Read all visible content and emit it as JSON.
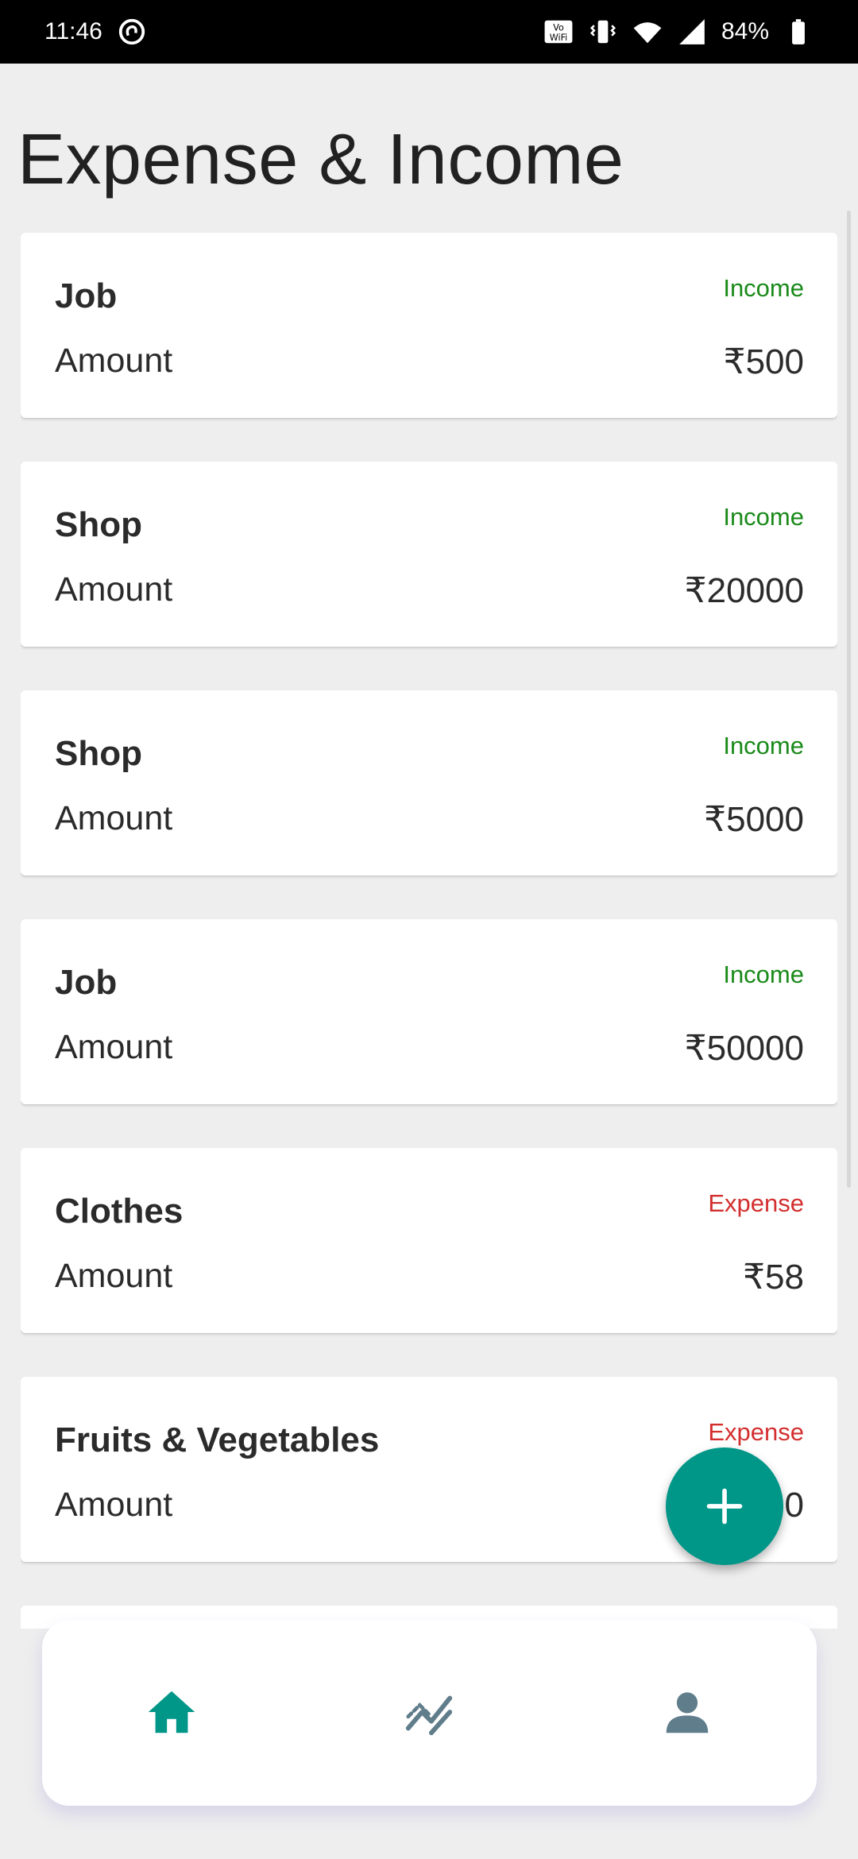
{
  "status_bar": {
    "time": "11:46",
    "battery": "84%",
    "icons": [
      "sync-icon",
      "vowifi-icon",
      "vibrate-icon",
      "wifi-icon",
      "signal-icon",
      "battery-icon"
    ]
  },
  "page": {
    "title": "Expense & Income"
  },
  "colors": {
    "accent": "#009688",
    "income": "#1a8a1a",
    "expense": "#d32f2f",
    "nav_inactive": "#607d8b"
  },
  "transactions": [
    {
      "category": "Job",
      "type": "Income",
      "amount_label": "Amount",
      "amount": "₹500"
    },
    {
      "category": "Shop",
      "type": "Income",
      "amount_label": "Amount",
      "amount": "₹20000"
    },
    {
      "category": "Shop",
      "type": "Income",
      "amount_label": "Amount",
      "amount": "₹5000"
    },
    {
      "category": "Job",
      "type": "Income",
      "amount_label": "Amount",
      "amount": "₹50000"
    },
    {
      "category": "Clothes",
      "type": "Expense",
      "amount_label": "Amount",
      "amount": "₹58"
    },
    {
      "category": "Fruits & Vegetables",
      "type": "Expense",
      "amount_label": "Amount",
      "amount": "0"
    }
  ],
  "fab": {
    "icon": "plus-icon"
  },
  "bottom_nav": {
    "items": [
      {
        "icon": "home-icon",
        "active": true
      },
      {
        "icon": "chart-trend-icon",
        "active": false
      },
      {
        "icon": "person-icon",
        "active": false
      }
    ]
  }
}
